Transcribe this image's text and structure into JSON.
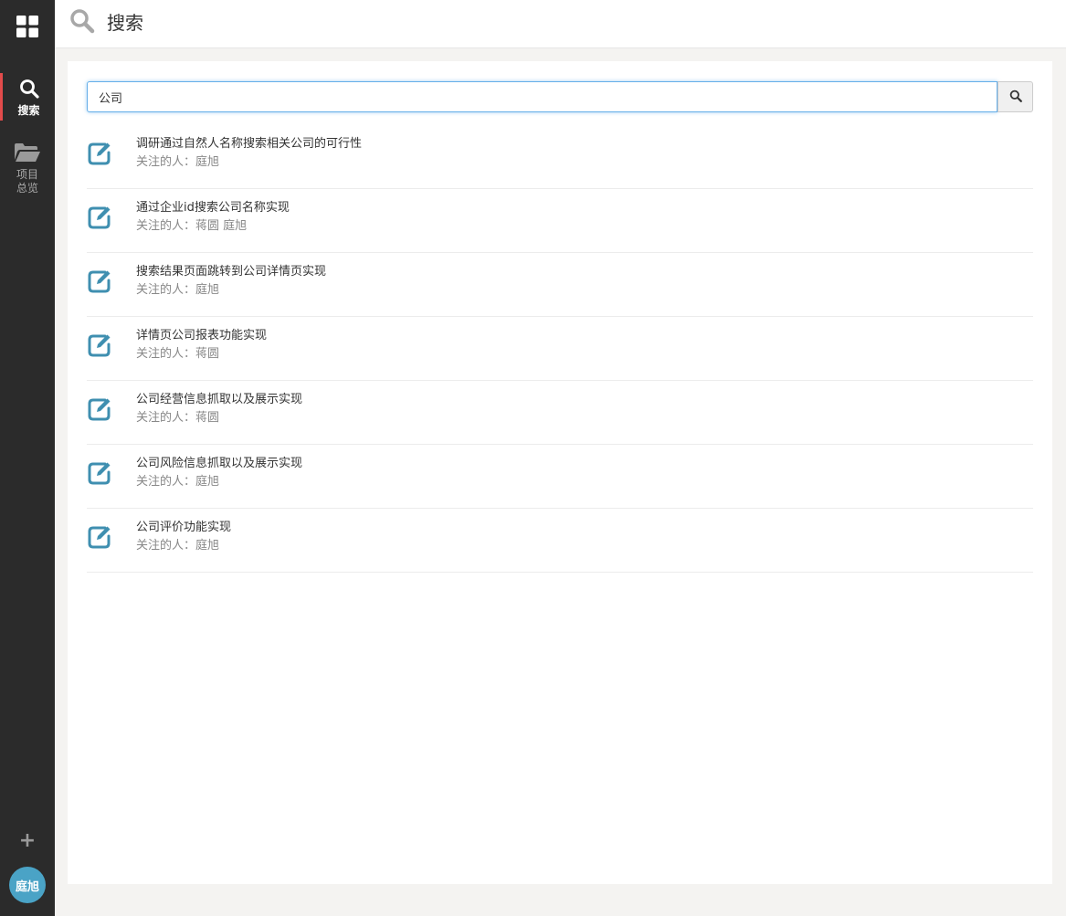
{
  "sidebar": {
    "logo_icon": "grid-icon",
    "items": [
      {
        "icon": "search-icon",
        "label": "搜索",
        "active": true
      },
      {
        "icon": "folder-open-icon",
        "label": "项目\n总览",
        "active": false
      }
    ],
    "add_icon": "plus-icon",
    "add_label": "+",
    "avatar_text": "庭旭",
    "accent_color": "#e24b4b",
    "avatar_color": "#4aa3c6"
  },
  "header": {
    "icon": "search-icon",
    "title": "搜索"
  },
  "search": {
    "value": "公司",
    "placeholder": "",
    "button_icon": "search-icon"
  },
  "results": [
    {
      "title": "调研通过自然人名称搜索相关公司的可行性",
      "followers_label": "关注的人：",
      "followers": "庭旭"
    },
    {
      "title": "通过企业id搜索公司名称实现",
      "followers_label": "关注的人：",
      "followers": "蒋圆 庭旭"
    },
    {
      "title": "搜索结果页面跳转到公司详情页实现",
      "followers_label": "关注的人：",
      "followers": "庭旭"
    },
    {
      "title": "详情页公司报表功能实现",
      "followers_label": "关注的人：",
      "followers": "蒋圆"
    },
    {
      "title": "公司经营信息抓取以及展示实现",
      "followers_label": "关注的人：",
      "followers": "蒋圆"
    },
    {
      "title": "公司风险信息抓取以及展示实现",
      "followers_label": "关注的人：",
      "followers": "庭旭"
    },
    {
      "title": "公司评价功能实现",
      "followers_label": "关注的人：",
      "followers": "庭旭"
    }
  ],
  "result_icon": "edit-icon",
  "result_icon_color": "#3f8fb0"
}
